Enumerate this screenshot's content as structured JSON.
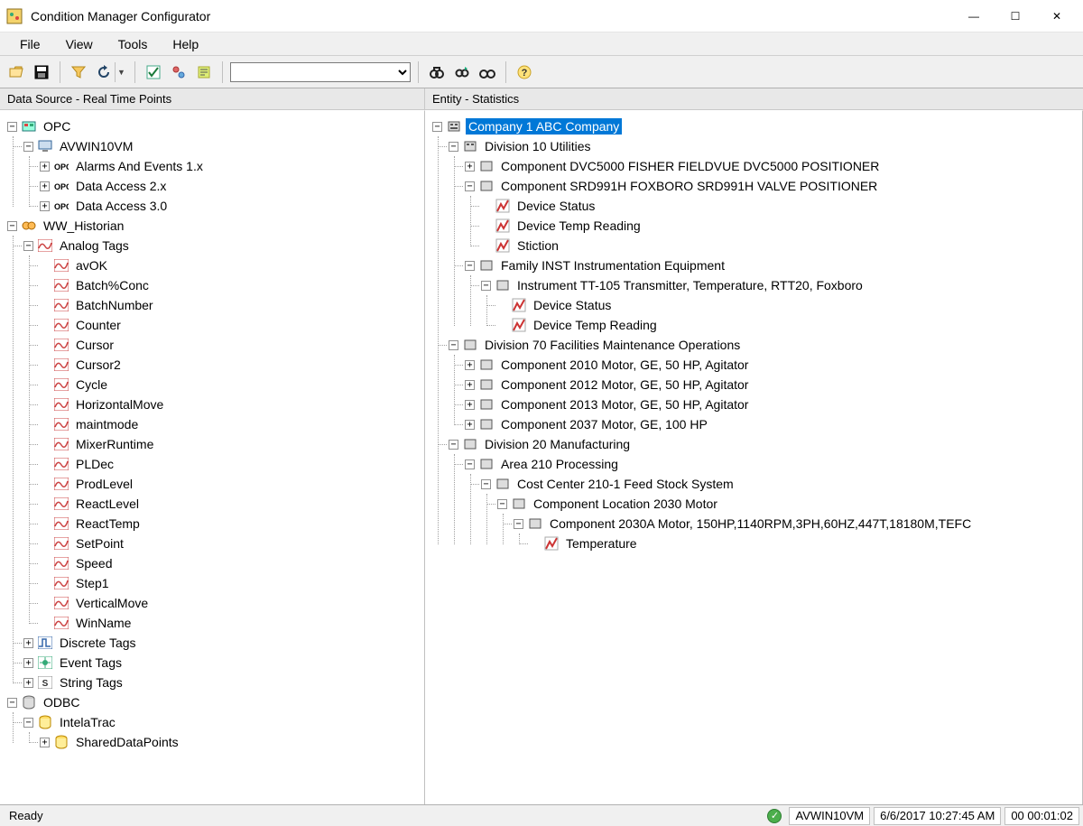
{
  "window": {
    "title": "Condition Manager Configurator",
    "minimize_glyph": "—",
    "maximize_glyph": "☐",
    "close_glyph": "✕"
  },
  "menubar": {
    "file": "File",
    "view": "View",
    "tools": "Tools",
    "help": "Help"
  },
  "toolbar": {
    "combo_value": ""
  },
  "panel_headers": {
    "left": "Data Source - Real Time Points",
    "right": "Entity - Statistics"
  },
  "left_tree": {
    "opc": "OPC",
    "avwin": "AVWIN10VM",
    "alarms": "Alarms And Events 1.x",
    "da2": "Data Access 2.x",
    "da3": "Data Access 3.0",
    "wwhist": "WW_Historian",
    "analog": "Analog Tags",
    "tags": {
      "avok": "avOK",
      "batchconc": "Batch%Conc",
      "batchnum": "BatchNumber",
      "counter": "Counter",
      "cursor": "Cursor",
      "cursor2": "Cursor2",
      "cycle": "Cycle",
      "hmove": "HorizontalMove",
      "maint": "maintmode",
      "mixer": "MixerRuntime",
      "pldec": "PLDec",
      "prodlev": "ProdLevel",
      "reactlev": "ReactLevel",
      "reacttemp": "ReactTemp",
      "setpoint": "SetPoint",
      "speed": "Speed",
      "step1": "Step1",
      "vmove": "VerticalMove",
      "winname": "WinName"
    },
    "discrete": "Discrete Tags",
    "event": "Event Tags",
    "string": "String Tags",
    "odbc": "ODBC",
    "intelatrac": "IntelaTrac",
    "shared": "SharedDataPoints"
  },
  "right_tree": {
    "company": "Company  1  ABC Company",
    "div10": "Division  10  Utilities",
    "comp_dvc": "Component  DVC5000  FISHER FIELDVUE DVC5000 POSITIONER",
    "comp_srd": "Component  SRD991H  FOXBORO SRD991H VALVE POSITIONER",
    "devstatus1": "Device Status",
    "devtemp1": "Device Temp Reading",
    "stiction": "Stiction",
    "family_inst": "Family  INST  Instrumentation Equipment",
    "instr_tt105": "Instrument  TT-105  Transmitter, Temperature, RTT20, Foxboro",
    "devstatus2": "Device Status",
    "devtemp2": "Device Temp Reading",
    "div70": "Division  70  Facilities Maintenance Operations",
    "comp2010": "Component  2010  Motor, GE, 50 HP, Agitator",
    "comp2012": "Component  2012  Motor, GE, 50 HP, Agitator",
    "comp2013": "Component  2013  Motor, GE, 50 HP, Agitator",
    "comp2037": "Component  2037  Motor, GE, 100 HP",
    "div20": "Division  20  Manufacturing",
    "area210": "Area  210  Processing",
    "cc2101": "Cost Center  210-1  Feed Stock System",
    "comploc2030": "Component Location  2030  Motor",
    "comp2030a": "Component  2030A  Motor, 150HP,1140RPM,3PH,60HZ,447T,18180M,TEFC",
    "temperature": "Temperature"
  },
  "status": {
    "ready": "Ready",
    "server": "AVWIN10VM",
    "timestamp": "6/6/2017 10:27:45 AM",
    "elapsed": "00 00:01:02"
  },
  "icons": {
    "app": "app-icon",
    "open": "open-icon",
    "save": "save-icon",
    "filter": "filter-icon",
    "refresh": "refresh-icon",
    "check": "check-icon",
    "tool1": "tool1-icon",
    "tool2": "tool2-icon",
    "find1": "find-icon",
    "find2": "find-next-icon",
    "find3": "find-all-icon",
    "help": "help-icon"
  }
}
